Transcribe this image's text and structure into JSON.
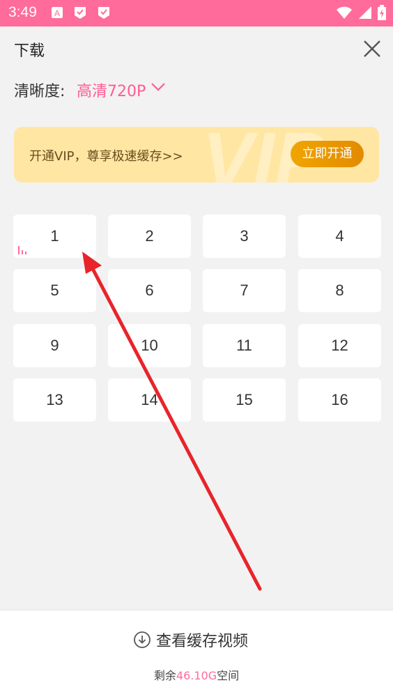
{
  "status_bar": {
    "time": "3:49"
  },
  "header": {
    "title": "下载"
  },
  "quality": {
    "label": "清晰度:",
    "value": "高清720P"
  },
  "vip_banner": {
    "text": "开通VIP，尊享极速缓存>>",
    "button": "立即开通"
  },
  "episodes": [
    "1",
    "2",
    "3",
    "4",
    "5",
    "6",
    "7",
    "8",
    "9",
    "10",
    "11",
    "12",
    "13",
    "14",
    "15",
    "16"
  ],
  "footer": {
    "button_label": "查看缓存视频",
    "storage_prefix": "剩余",
    "storage_amount": "46.10G",
    "storage_suffix": "空间"
  },
  "colors": {
    "accent": "#ff5c95",
    "status_bar": "#ff6b9a",
    "vip_bg": "#ffe6a3",
    "arrow": "#e8242b"
  }
}
